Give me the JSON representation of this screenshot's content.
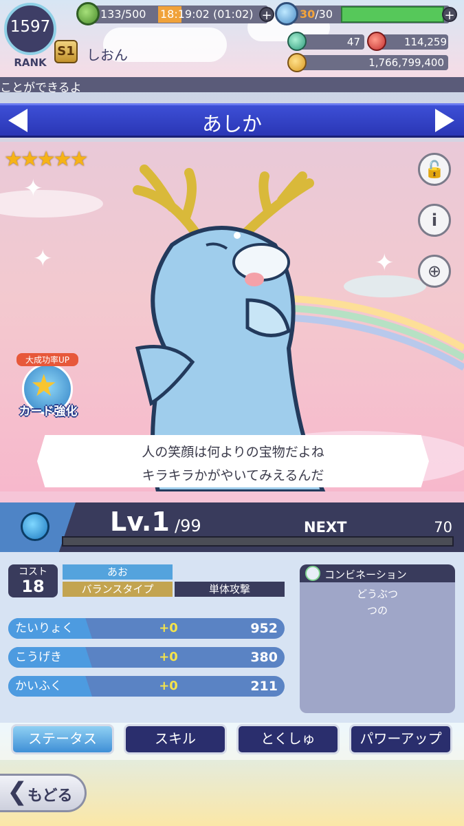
{
  "rank": {
    "value": "1597",
    "label": "RANK"
  },
  "stamina": {
    "text": "133/500",
    "timer": "18:19:02 (01:02)"
  },
  "potion": {
    "current": "30",
    "max": "/30"
  },
  "player": {
    "badge": "S1",
    "name": "しおん"
  },
  "currency": {
    "gems": "47",
    "ruby": "114,259",
    "coins": "1,766,799,400"
  },
  "ticker": {
    "text": "ことができるよ"
  },
  "card": {
    "name": "あしか",
    "stars": "★★★★★",
    "rarity_stars": 5,
    "dialogue_line1": "人の笑顔は何よりの宝物だよね",
    "dialogue_line2": "キラキラかがやいてみえるんだ",
    "powerup_top": "大成功率UP",
    "powerup_label": "カード強化"
  },
  "buttons": {
    "lock": "🔓",
    "info": "i",
    "zoom": "⊕"
  },
  "level": {
    "label": "Lv.1",
    "max": "/99",
    "next_label": "NEXT",
    "next_value": "70",
    "exp_fraction": 0.0
  },
  "stats": {
    "cost_label": "コスト",
    "cost_value": "18",
    "attribute": "あお",
    "type": "バランスタイプ",
    "attack_style": "単体攻撃",
    "rows": [
      {
        "label": "たいりょく",
        "bonus": "+0",
        "value": "952"
      },
      {
        "label": "こうげき",
        "bonus": "+0",
        "value": "380"
      },
      {
        "label": "かいふく",
        "bonus": "+0",
        "value": "211"
      }
    ]
  },
  "combination": {
    "title": "コンビネーション",
    "items": [
      "どうぶつ",
      "つの"
    ]
  },
  "tabs": [
    "ステータス",
    "スキル",
    "とくしゅ",
    "パワーアップ"
  ],
  "back": {
    "chevron": "❮",
    "label": "もどる"
  },
  "colors": {
    "banner": "#2a36b5",
    "panel": "#393b5c",
    "accent_blue": "#4d9be0",
    "gold": "#c3a450"
  }
}
